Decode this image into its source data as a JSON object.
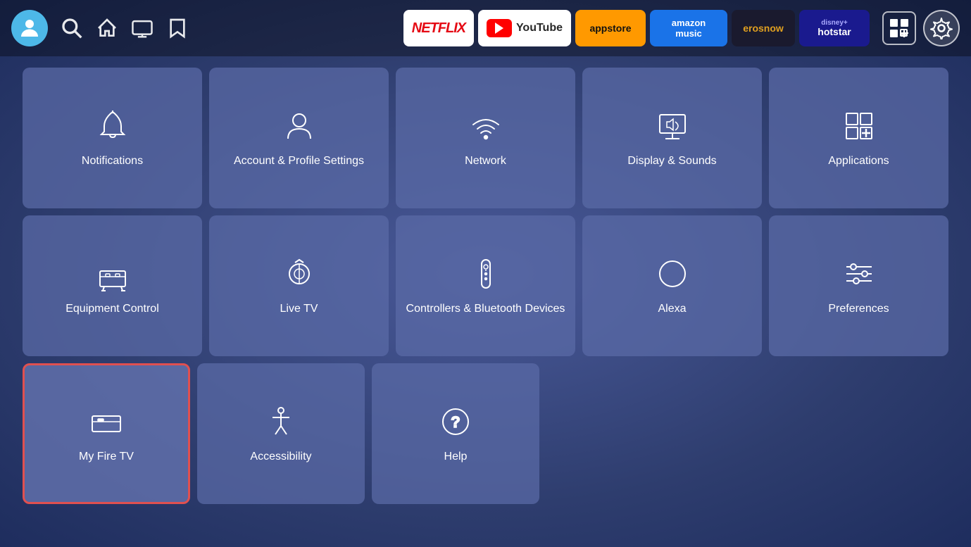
{
  "header": {
    "apps": [
      {
        "id": "netflix",
        "label": "NETFLIX"
      },
      {
        "id": "youtube",
        "label": "YouTube"
      },
      {
        "id": "appstore",
        "label": "appstore"
      },
      {
        "id": "amazon-music",
        "label": "amazon music"
      },
      {
        "id": "erosnow",
        "label": "erosnow"
      },
      {
        "id": "hotstar",
        "label": "disney+ hotstar"
      }
    ]
  },
  "grid": {
    "row1": [
      {
        "id": "notifications",
        "label": "Notifications"
      },
      {
        "id": "account-profile",
        "label": "Account & Profile Settings"
      },
      {
        "id": "network",
        "label": "Network"
      },
      {
        "id": "display-sounds",
        "label": "Display & Sounds"
      },
      {
        "id": "applications",
        "label": "Applications"
      }
    ],
    "row2": [
      {
        "id": "equipment-control",
        "label": "Equipment Control"
      },
      {
        "id": "live-tv",
        "label": "Live TV"
      },
      {
        "id": "controllers-bluetooth",
        "label": "Controllers & Bluetooth Devices"
      },
      {
        "id": "alexa",
        "label": "Alexa"
      },
      {
        "id": "preferences",
        "label": "Preferences"
      }
    ],
    "row3": [
      {
        "id": "my-fire-tv",
        "label": "My Fire TV",
        "selected": true
      },
      {
        "id": "accessibility",
        "label": "Accessibility"
      },
      {
        "id": "help",
        "label": "Help"
      }
    ]
  }
}
